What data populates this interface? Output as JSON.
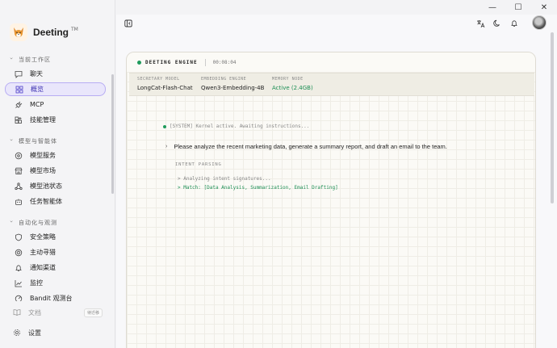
{
  "window": {
    "minimize_glyph": "—",
    "maximize_glyph": "☐",
    "close_glyph": "✕"
  },
  "brand": {
    "name": "Deeting",
    "tm": "TM"
  },
  "sidebar": {
    "sections": [
      {
        "title": "当前工作区",
        "items": [
          {
            "label": "聊天",
            "icon": "chat-icon",
            "active": false
          },
          {
            "label": "概览",
            "icon": "grid-icon",
            "active": true
          },
          {
            "label": "MCP",
            "icon": "plug-icon",
            "active": false
          },
          {
            "label": "技能管理",
            "icon": "blocks-icon",
            "active": false
          }
        ]
      },
      {
        "title": "模型与智能体",
        "items": [
          {
            "label": "模型服务",
            "icon": "server-icon",
            "active": false
          },
          {
            "label": "模型市场",
            "icon": "store-icon",
            "active": false
          },
          {
            "label": "模型池状态",
            "icon": "network-icon",
            "active": false
          },
          {
            "label": "任务智能体",
            "icon": "robot-icon",
            "active": false
          }
        ]
      },
      {
        "title": "自动化与观测",
        "items": [
          {
            "label": "安全策略",
            "icon": "shield-icon",
            "active": false
          },
          {
            "label": "主动寻猎",
            "icon": "target-icon",
            "active": false
          },
          {
            "label": "通知渠道",
            "icon": "bell-icon",
            "active": false
          },
          {
            "label": "监控",
            "icon": "chart-icon",
            "active": false
          },
          {
            "label": "Bandit 观测台",
            "icon": "radar-icon",
            "active": false
          }
        ]
      }
    ],
    "footer": {
      "docs_label": "文档",
      "docs_tag": "待迁移",
      "settings_label": "设置"
    }
  },
  "card": {
    "engine_label": "DEETING ENGINE",
    "clock": "00:08:04",
    "info": [
      {
        "label": "SECRETARY MODEL",
        "value": "LongCat-Flash-Chat"
      },
      {
        "label": "EMBEDDING ENGINE",
        "value": "Qwen3-Embedding-4B"
      },
      {
        "label": "MEMORY NODE",
        "value": "Active (2.4GB)"
      }
    ],
    "system_line": "[SYSTEM] Kernel active. Awaiting instructions...",
    "prompt": "Please analyze the recent marketing data, generate a summary report, and draft an email to the team.",
    "intent_title": "INTENT PARSING",
    "intent_lines": [
      "> Analyzing intent signatures...",
      "> Match: [Data Analysis, Summarization, Email Drafting]"
    ]
  },
  "colors": {
    "accent": "#4b3ec7",
    "active_bg": "#e9e6fb",
    "status_green": "#1d8f55"
  }
}
